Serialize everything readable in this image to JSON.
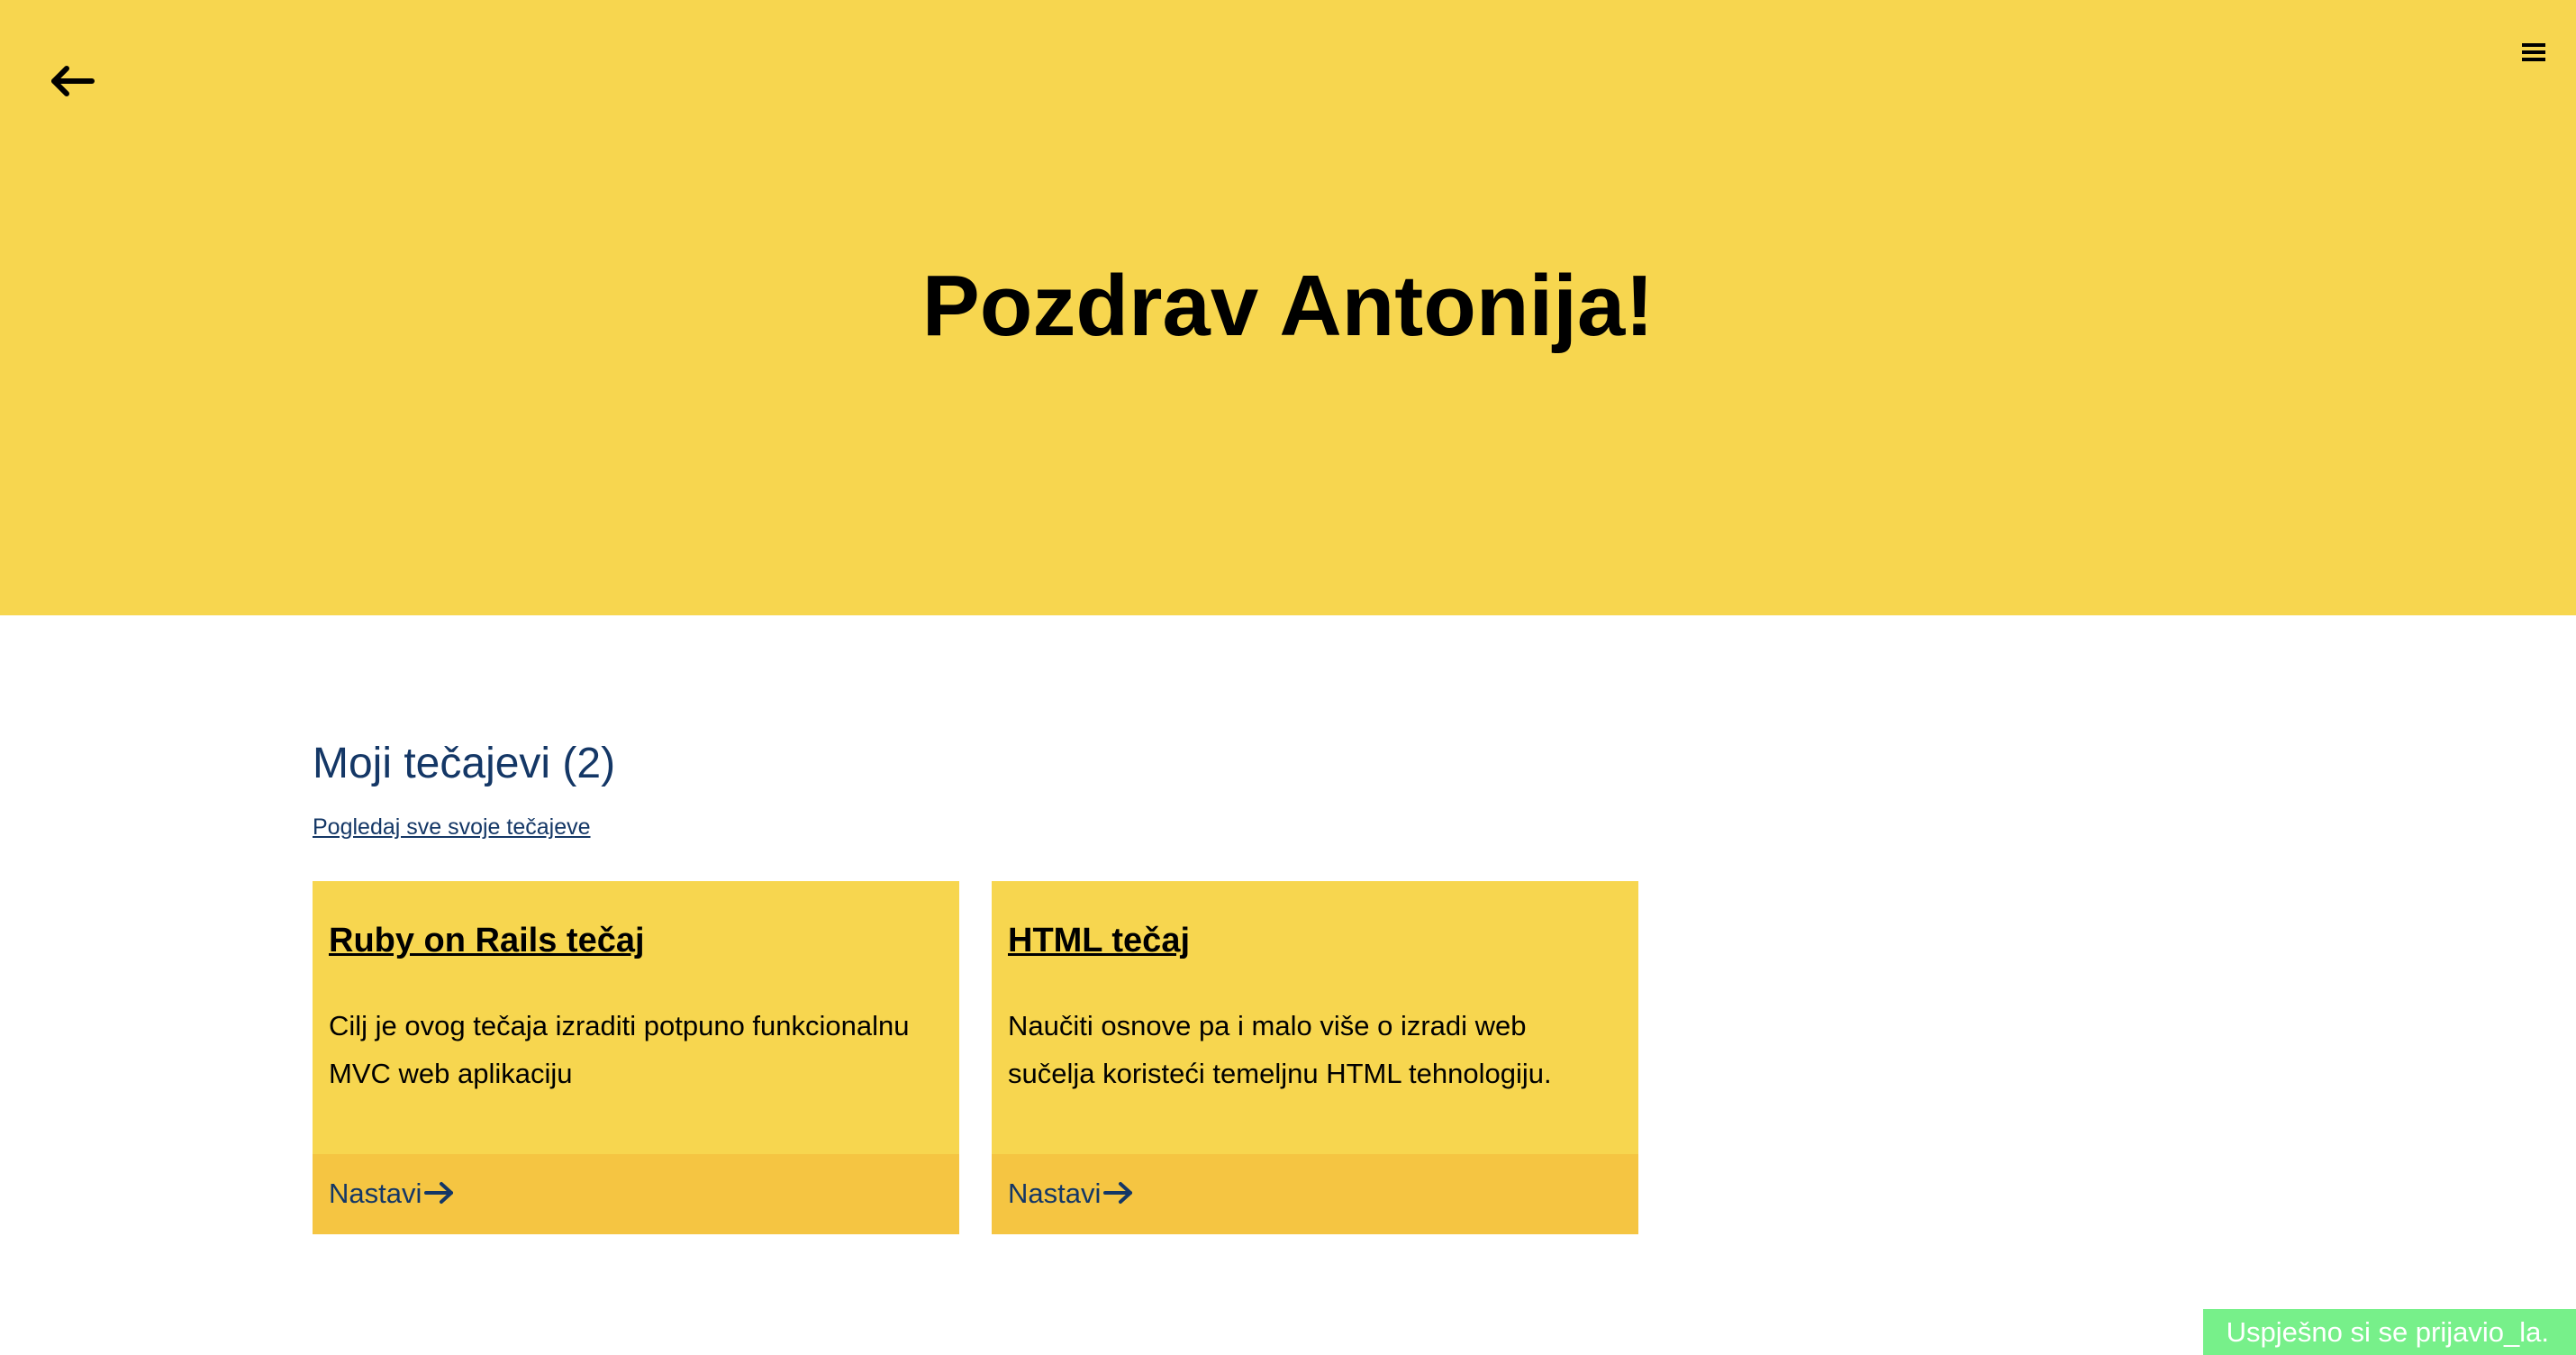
{
  "header": {
    "back_icon": "arrow-left-icon",
    "menu_icon": "hamburger-menu-icon",
    "greeting": "Pozdrav Antonija!"
  },
  "courses_section": {
    "title": "Moji tečajevi (2)",
    "view_all_link": "Pogledaj sve svoje tečajeve",
    "courses": [
      {
        "title": "Ruby on Rails tečaj",
        "description": "Cilj je ovog tečaja izraditi potpuno funkcionalnu MVC web aplikaciju",
        "continue_label": "Nastavi",
        "continue_icon": "arrow-right-icon"
      },
      {
        "title": "HTML tečaj",
        "description": "Naučiti osnove pa i malo više o izradi web sučelja koristeći temeljnu HTML tehnologiju.",
        "continue_label": "Nastavi",
        "continue_icon": "arrow-right-icon"
      }
    ]
  },
  "toast": {
    "message": "Uspješno si se prijavio_la."
  },
  "colors": {
    "hero_background": "#f7d64f",
    "card_background": "#f7d64f",
    "card_footer_background": "#f5c542",
    "heading_blue": "#143766",
    "toast_background": "#77f08a"
  }
}
